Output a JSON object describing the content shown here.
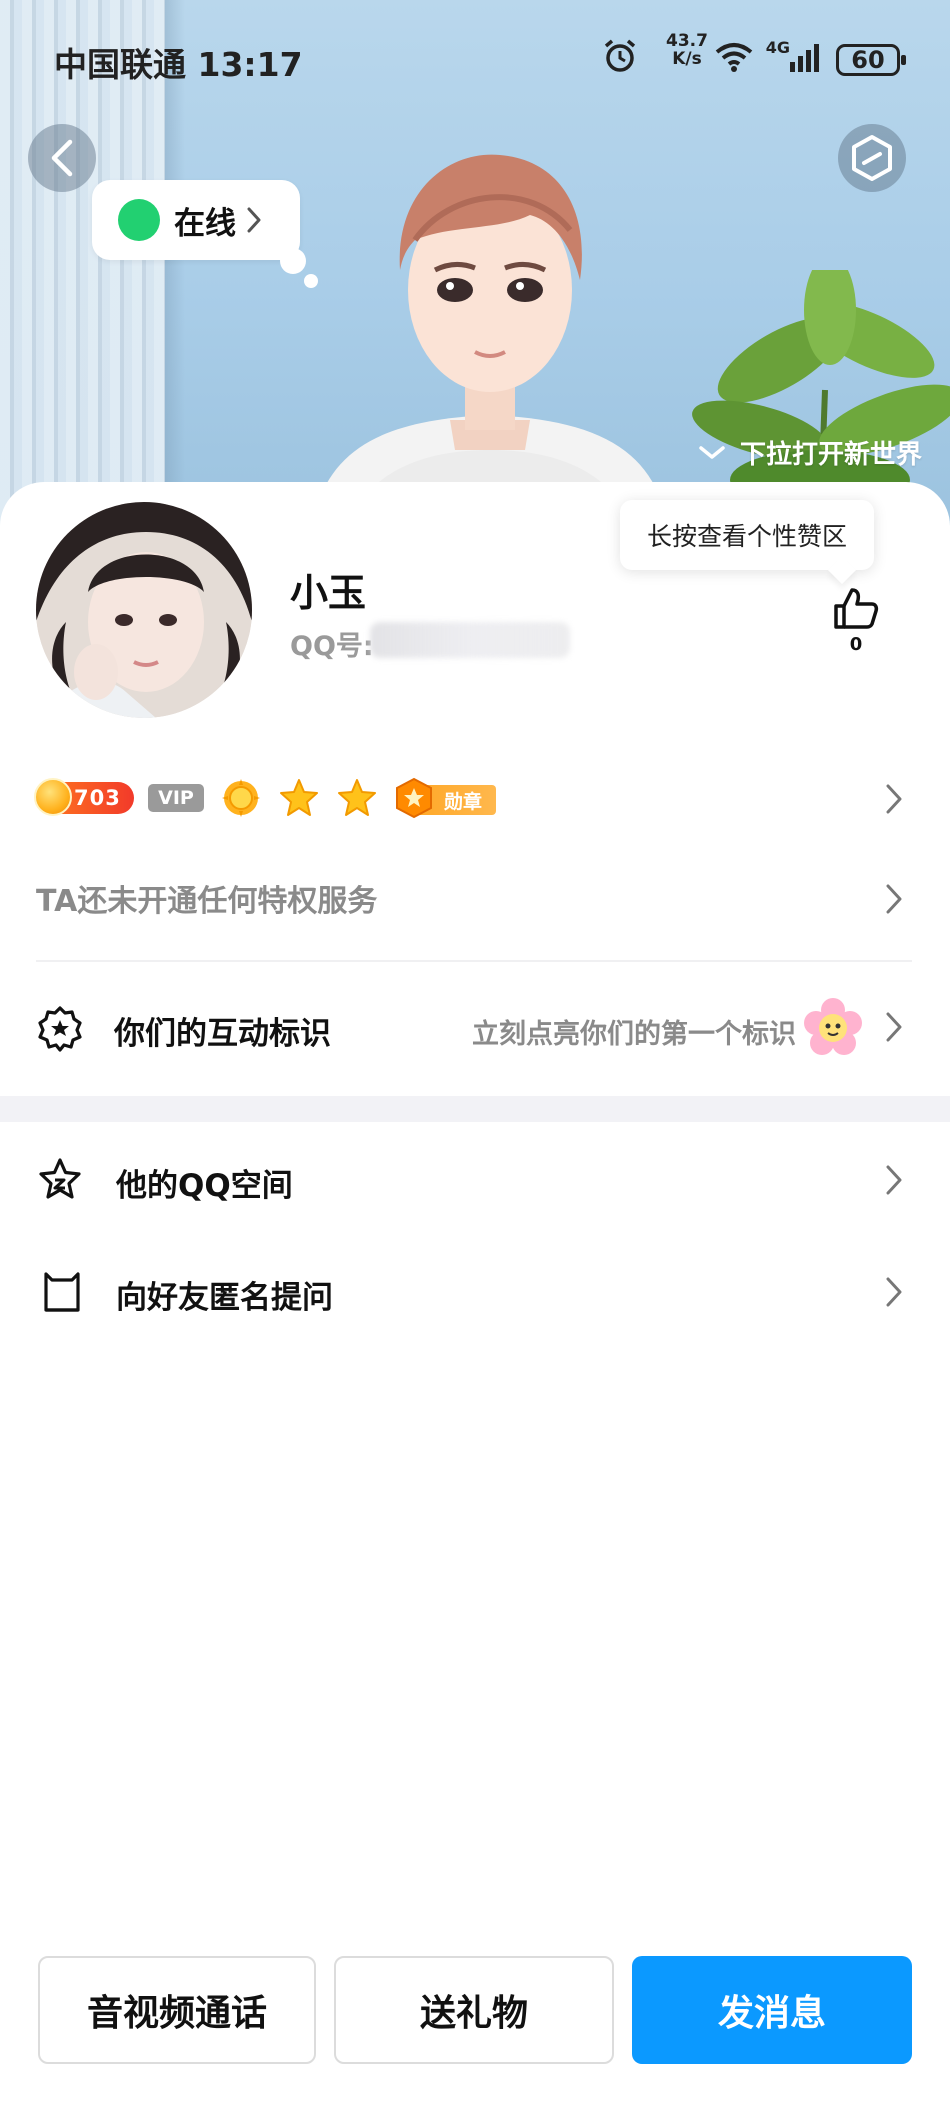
{
  "status_bar": {
    "carrier_time": "中国联通 13:17",
    "net_speed_value": "43.7",
    "net_speed_unit": "K/s",
    "network": "4G",
    "battery": "60"
  },
  "hero": {
    "online_status": "在线",
    "pulldown_hint": "下拉打开新世界"
  },
  "profile": {
    "name": "小玉",
    "qq_label": "QQ号:",
    "like_tip": "长按查看个性赞区",
    "like_count": "0"
  },
  "badges": {
    "level": "703",
    "vip": "VIP",
    "medal": "勋章",
    "colors": {
      "level_start": "#ff7a1e",
      "level_end": "#f23a2a",
      "medal": "#ffa726"
    }
  },
  "rows": {
    "privilege": "TA还未开通任何特权服务",
    "interaction_label": "你们的互动标识",
    "interaction_hint": "立刻点亮你们的第一个标识",
    "qzone": "他的QQ空间",
    "anonymous_question": "向好友匿名提问"
  },
  "actions": {
    "call": "音视频通话",
    "gift": "送礼物",
    "message": "发消息",
    "primary_color": "#0b99ff"
  },
  "icons": [
    "back-arrow-icon",
    "hexagon-icon",
    "chevron-right-icon",
    "thumbs-up-icon",
    "gear-star-icon",
    "star-person-icon",
    "box-cat-icon",
    "flower-icon"
  ]
}
